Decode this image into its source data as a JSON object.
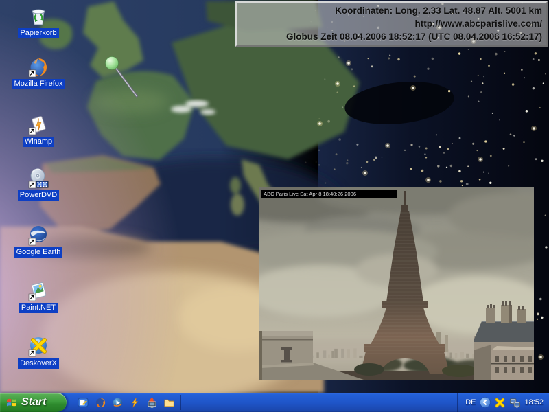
{
  "desktop": {
    "icons": [
      {
        "id": "papierkorb",
        "label": "Papierkorb",
        "shortcut": false
      },
      {
        "id": "firefox",
        "label": "Mozilla Firefox",
        "shortcut": true
      },
      {
        "id": "winamp",
        "label": "Winamp",
        "shortcut": true
      },
      {
        "id": "powerdvd",
        "label": "PowerDVD",
        "shortcut": true
      },
      {
        "id": "google-earth",
        "label": "Google Earth",
        "shortcut": true
      },
      {
        "id": "paint-net",
        "label": "Paint.NET",
        "shortcut": true
      },
      {
        "id": "deskoverx",
        "label": "DeskoverX",
        "shortcut": true
      }
    ],
    "location_pin": "pin-over-paris"
  },
  "info_box": {
    "line1": "Koordinaten: Long. 2.33 Lat. 48.87 Alt. 5001 km",
    "line2": "http://www.abcparislive.com/",
    "line3": "Globus Zeit 08.04.2006 18:52:17 (UTC 08.04.2006 16:52:17)"
  },
  "webcam": {
    "caption": "ABC Paris Live  Sat Apr 8 18:40:26 2006",
    "subject": "eiffel-tower-paris"
  },
  "taskbar": {
    "start_label": "Start",
    "quick_launch": [
      "show-desktop",
      "firefox",
      "media-player",
      "winamp",
      "nero-burning",
      "folder"
    ],
    "tray": {
      "language": "DE",
      "icons": [
        "collapse-chevron",
        "deskoverx",
        "network"
      ],
      "time": "18:52"
    }
  },
  "colors": {
    "taskbar_blue": "#245edb",
    "start_green": "#3c9c3c",
    "icon_label_bg": "#0d3fc4",
    "info_box_bg": "#c4c4c4",
    "night_light": "#fff6d8"
  }
}
